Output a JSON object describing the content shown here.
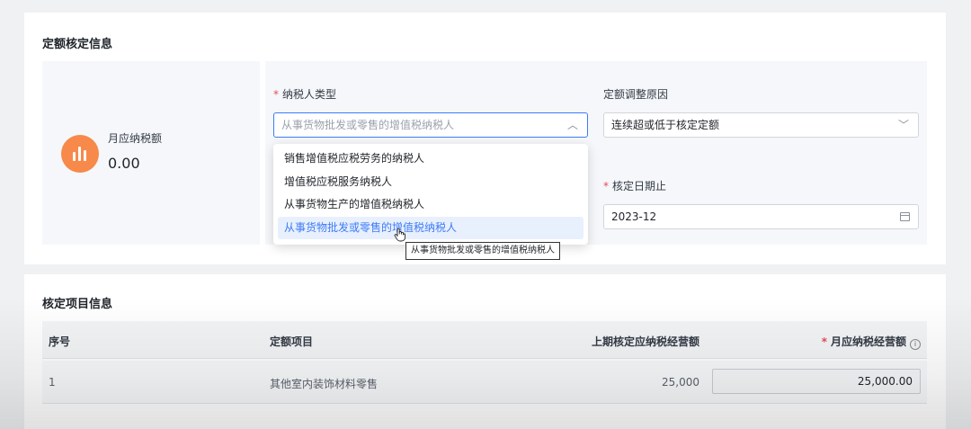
{
  "quota_section": {
    "title": "定额核定信息",
    "stat": {
      "label": "月应纳税额",
      "value": "0.00",
      "icon": "bar-chart-icon",
      "icon_color": "#f7894a"
    },
    "taxpayer_type": {
      "label": "纳税人类型",
      "placeholder": "从事货物批发或零售的增值税纳税人",
      "options": [
        "销售增值税应税劳务的纳税人",
        "增值税应税服务纳税人",
        "从事货物生产的增值税纳税人",
        "从事货物批发或零售的增值税纳税人"
      ],
      "tooltip": "从事货物批发或零售的增值税纳税人"
    },
    "adjust_reason": {
      "label": "定额调整原因",
      "value": "连续超或低于核定定额"
    },
    "end_date": {
      "label": "核定日期止",
      "value": "2023-12"
    }
  },
  "items_section": {
    "title": "核定项目信息",
    "columns": [
      "序号",
      "定额项目",
      "上期核定应纳税经营额",
      "月应纳税经营额"
    ],
    "rows": [
      {
        "index": "1",
        "item": "其他室内装饰材料零售",
        "prev_amount": "25,000",
        "monthly_amount": "25,000.00"
      }
    ]
  },
  "colors": {
    "accent": "#3d7bf7",
    "required": "#e34d59"
  }
}
